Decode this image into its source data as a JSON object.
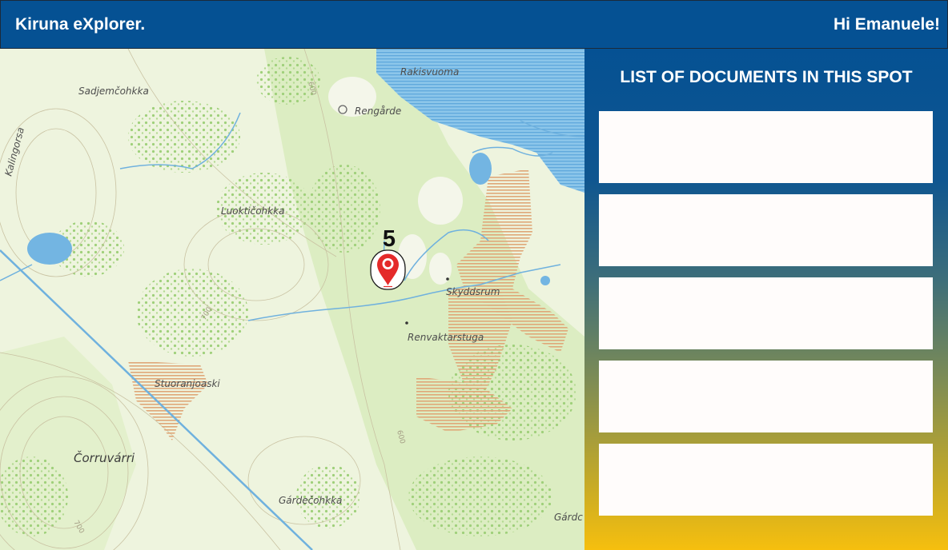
{
  "header": {
    "app_title": "Kiruna eXplorer.",
    "greeting": "Hi Emanuele!"
  },
  "map": {
    "place_names": {
      "sadjemcohkka": "Sadjemčohkka",
      "rakisvuoma": "Rakisvuoma",
      "rengarde": "Rengårde",
      "luokticohkka": "Luoktičohkka",
      "skyddsrum": "Skyddsrum",
      "renvaktarstuga": "Renvaktarstuga",
      "stuoranjoaski": "Stuoranjoaski",
      "corruvarri": "Čorruvárri",
      "gardecohkka": "Gárdečohkka",
      "gardc": "Gárdc",
      "kalingorsa": "Kalingorsa"
    },
    "contour_labels": [
      "600",
      "700",
      "600",
      "700"
    ],
    "marker": {
      "document_count": "5",
      "icon": "map-pin-icon"
    },
    "colors": {
      "land": "#eef4de",
      "forest": "#d9ebbd",
      "water": "#73b5e2",
      "marsh": "#e6b98f",
      "pin": "#e42a2a"
    }
  },
  "documents_panel": {
    "title": "LIST OF DOCUMENTS IN THIS SPOT",
    "documents": [
      {
        "label": ""
      },
      {
        "label": ""
      },
      {
        "label": ""
      },
      {
        "label": ""
      },
      {
        "label": ""
      }
    ]
  },
  "colors": {
    "header_bg": "#055193",
    "panel_gradient_top": "#055193",
    "panel_gradient_bottom": "#f6bf0e",
    "card_bg": "#fffcfb"
  }
}
